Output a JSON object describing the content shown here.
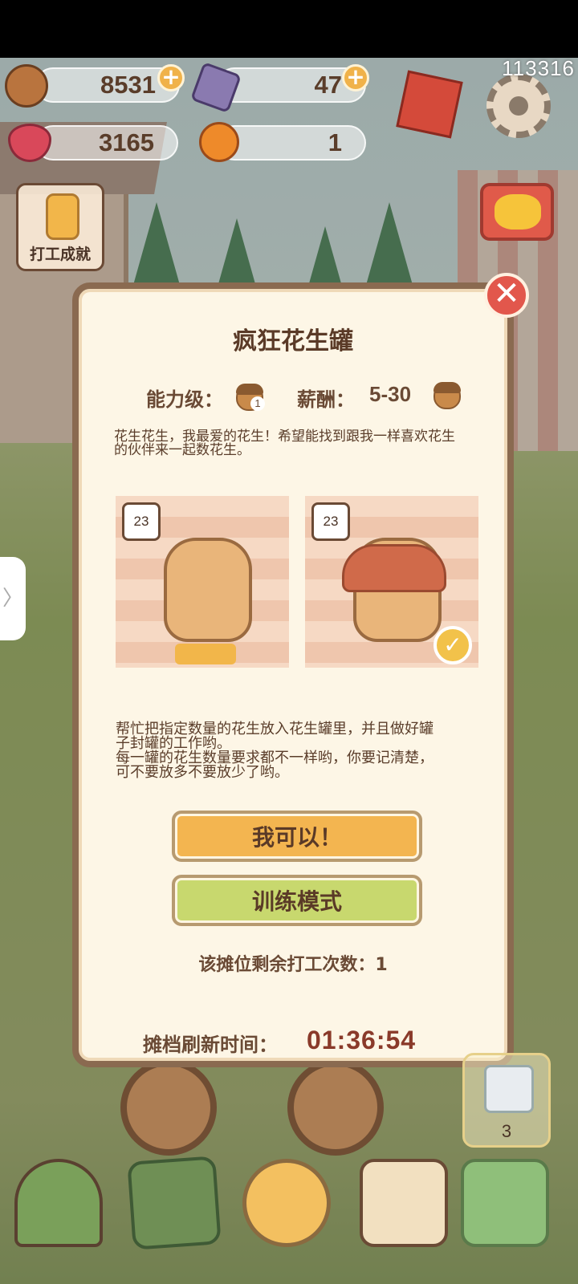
{
  "resources": {
    "acorns": "8531",
    "gems": "47",
    "hearts": "3165",
    "oranges": "1"
  },
  "user_id": "113316",
  "achievement_label": "打工成就",
  "modal": {
    "title": "疯狂花生罐",
    "ability_label": "能力级：",
    "ability_level": "1",
    "pay_label": "薪酬：",
    "pay_range": "5-30",
    "intro_line1": "花生花生，我最爱的花生！希望能找到跟我一样喜欢花生",
    "intro_line2": "的伙伴来一起数花生。",
    "example_count_1": "23",
    "example_count_2": "23",
    "instr_line1": "帮忙把指定数量的花生放入花生罐里，并且做好罐",
    "instr_line2": "子封罐的工作哟。",
    "instr_line3": "每一罐的花生数量要求都不一样哟，你要记清楚，",
    "instr_line4": "可不要放多不要放少了哟。",
    "btn_accept": "我可以！",
    "btn_training": "训练模式",
    "remaining_text": "该摊位剩余打工次数：1",
    "refresh_label": "摊档刷新时间：",
    "refresh_time": "01:36:54",
    "close_symbol": "✕"
  },
  "gift_count": "3",
  "side_tab_symbol": "〉",
  "icons": {
    "acorn": "acorn-icon",
    "gem": "gem-icon",
    "heart": "heart-icon",
    "orange": "orange-icon",
    "settings": "gear-icon",
    "book": "book-icon",
    "tv": "tv-icon",
    "gift": "gift-icon"
  },
  "colors": {
    "accept_button": "#f3b550",
    "training_button": "#c8d86e",
    "close_button": "#e2574c",
    "timer_text": "#8a3a2a"
  }
}
